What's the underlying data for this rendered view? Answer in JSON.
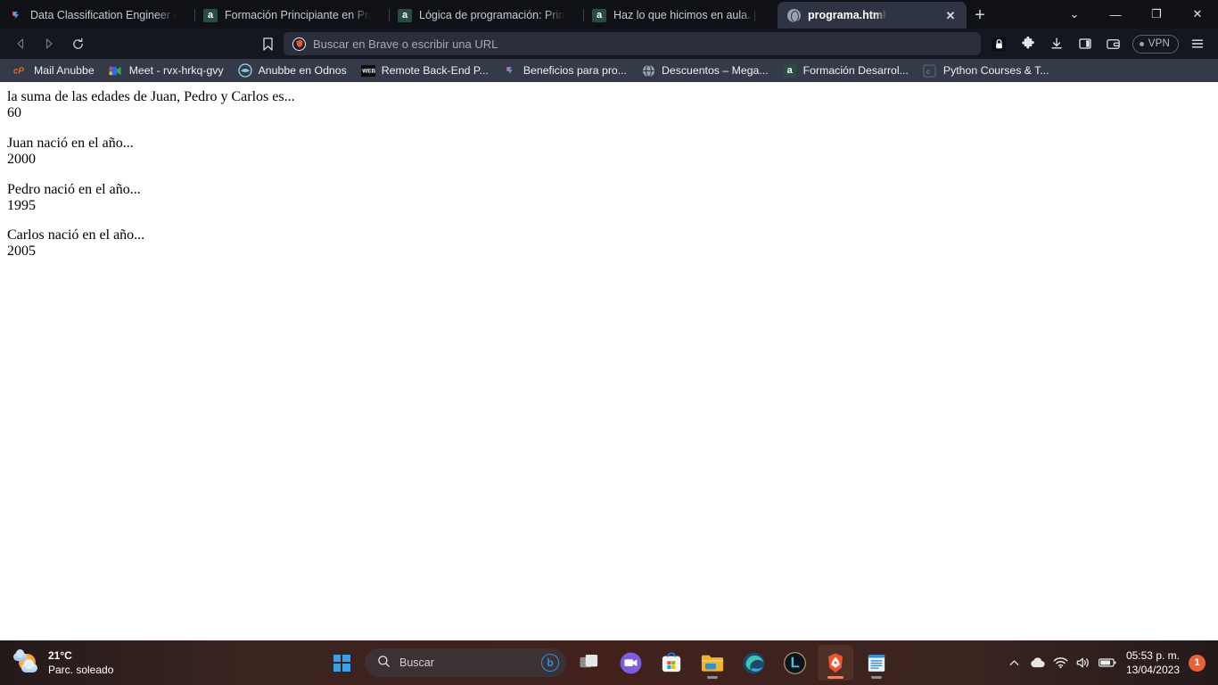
{
  "browser": {
    "name": "Brave",
    "tabs": [
      {
        "title": "Data Classification Engineer en Ad",
        "favicon": "platzi-icon",
        "active": false
      },
      {
        "title": "Formación Principiante en Program",
        "favicon": "alura-icon",
        "active": false
      },
      {
        "title": "Lógica de programación: Primeros",
        "favicon": "alura-icon",
        "active": false
      },
      {
        "title": "Haz lo que hicimos en aula. | Lógic",
        "favicon": "alura-icon",
        "active": false
      },
      {
        "title": "programa.html",
        "favicon": "globe-icon",
        "active": true
      }
    ],
    "tab_close_label": "✕",
    "new_tab_label": "+",
    "window_controls": {
      "tab_search": "⌄",
      "minimize": "—",
      "maximize": "❐",
      "close": "✕"
    },
    "toolbar": {
      "back_label": "◁",
      "forward_label": "▷",
      "reload_label": "⟳",
      "bookmark_label": "bookmark",
      "omnibox_placeholder": "Buscar en Brave o escribir una URL",
      "omnibox_value": "",
      "icons": [
        "shields-icon",
        "extensions-icon",
        "downloads-icon",
        "sidebar-icon",
        "wallet-icon"
      ],
      "vpn_label": "VPN"
    },
    "bookmarks": [
      {
        "label": "Mail Anubbe",
        "icon": "cpanel-icon",
        "color": "#e8621d"
      },
      {
        "label": "Meet - rvx-hrkq-gvy",
        "icon": "google-meet-icon",
        "color": "#1a73e8"
      },
      {
        "label": "Anubbe en Odnos",
        "icon": "odnos-icon",
        "color": "#7ec8e3"
      },
      {
        "label": "Remote Back-End P...",
        "icon": "dark-square-icon",
        "color": "#ffffff"
      },
      {
        "label": "Beneficios para pro...",
        "icon": "platzi-icon",
        "color": "#e3457c"
      },
      {
        "label": "Descuentos – Mega...",
        "icon": "globe-icon",
        "color": "#9aa0ae"
      },
      {
        "label": "Formación Desarrol...",
        "icon": "alura-icon",
        "color": "#2a4b46"
      },
      {
        "label": "Python Courses & T...",
        "icon": "code-icon",
        "color": "#4a5b78"
      }
    ]
  },
  "page": {
    "blocks": [
      {
        "label": "la suma de las edades de Juan, Pedro y Carlos es...",
        "value": "60"
      },
      {
        "label": "Juan nació en el año...",
        "value": "2000"
      },
      {
        "label": "Pedro nació en el año...",
        "value": "1995"
      },
      {
        "label": "Carlos nació en el año...",
        "value": "2005"
      }
    ]
  },
  "taskbar": {
    "weather": {
      "temperature": "21°C",
      "condition": "Parc. soleado"
    },
    "search": {
      "placeholder": "Buscar"
    },
    "apps": [
      {
        "name": "task-view",
        "running": false
      },
      {
        "name": "microsoft-teams",
        "running": false
      },
      {
        "name": "microsoft-store",
        "running": false
      },
      {
        "name": "file-explorer",
        "running": true
      },
      {
        "name": "microsoft-edge",
        "running": false
      },
      {
        "name": "league-of-legends",
        "running": false
      },
      {
        "name": "brave-browser",
        "running": true,
        "active": true
      },
      {
        "name": "notepad",
        "running": true
      }
    ],
    "tray": {
      "overflow": "⌃",
      "onedrive": "cloud",
      "wifi": "wifi",
      "volume": "volume",
      "battery": "battery",
      "time": "05:53 p. m.",
      "date": "13/04/2023",
      "notification_count": "1"
    }
  }
}
